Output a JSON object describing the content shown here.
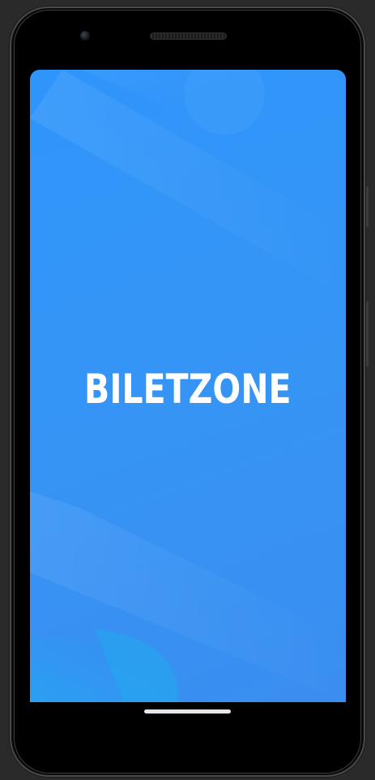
{
  "app": {
    "logo_text": "BILETZONE"
  },
  "colors": {
    "screen_background": "#3595f6",
    "logo_color": "#ffffff",
    "device_frame": "#000000",
    "home_indicator": "#e6e6e6"
  },
  "icons": {
    "front_camera": "camera-icon",
    "earpiece_speaker": "speaker-icon"
  }
}
